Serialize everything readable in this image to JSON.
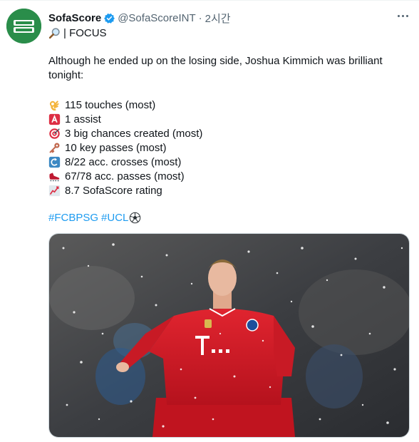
{
  "author": {
    "name": "SofaScore",
    "handle": "@SofaScoreINT",
    "separator": "·",
    "time": "2시간"
  },
  "tweet": {
    "focus_label": "| FOCUS",
    "intro": "Although he ended up on the losing side, Joshua Kimmich was brilliant tonight:",
    "stats": [
      {
        "icon": "ok-hand-icon",
        "text": "115 touches (most)"
      },
      {
        "icon": "letter-a-icon",
        "text": "1 assist"
      },
      {
        "icon": "target-icon",
        "text": "3 big chances created (most)"
      },
      {
        "icon": "key-icon",
        "text": "10 key passes (most)"
      },
      {
        "icon": "curved-arrow-icon",
        "text": "8/22 acc. crosses (most)"
      },
      {
        "icon": "football-boot-icon",
        "text": "67/78 acc. passes (most)"
      },
      {
        "icon": "chart-up-icon",
        "text": "8.7 SofaScore rating"
      }
    ],
    "hashtags": [
      "#FCBPSG",
      "#UCL"
    ]
  },
  "colors": {
    "link": "#1d9bf0",
    "verified": "#1d9bf0",
    "brand": "#2a8d4a",
    "jersey": "#d6202b"
  }
}
